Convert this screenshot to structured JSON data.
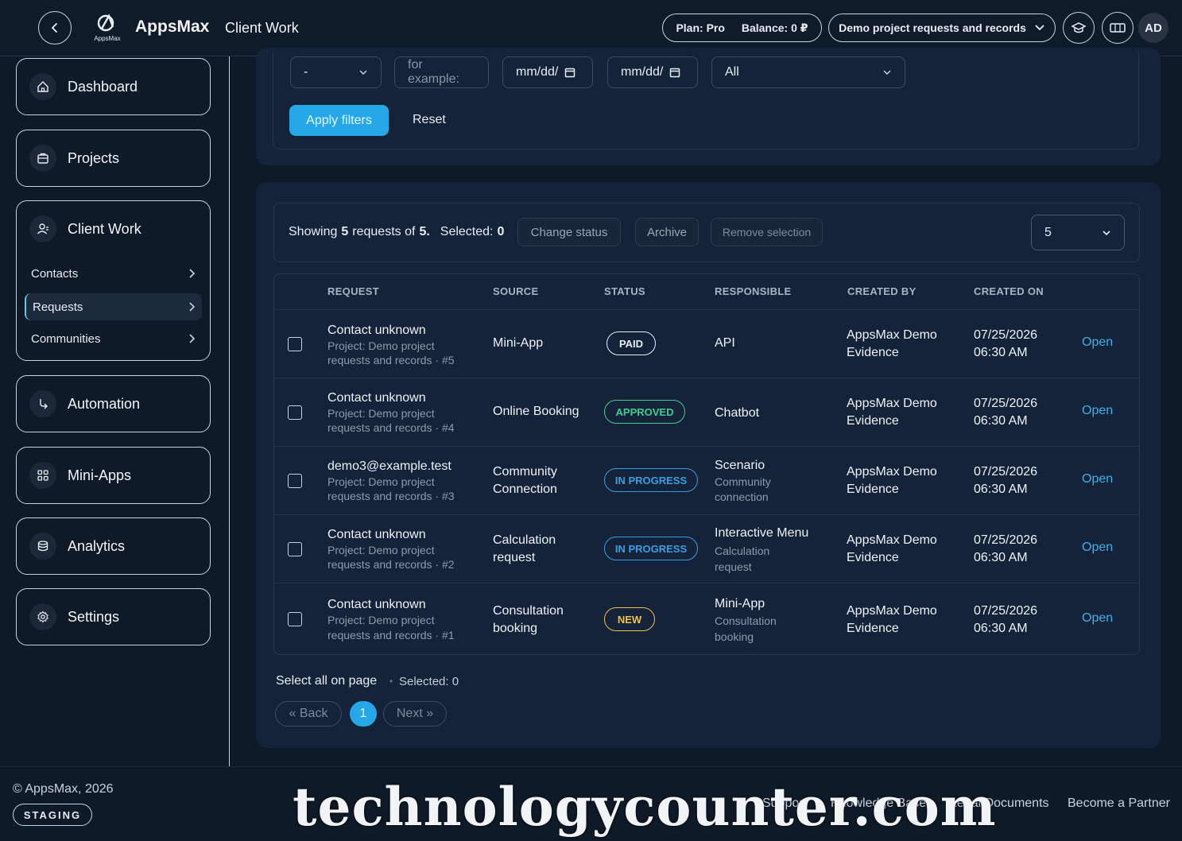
{
  "header": {
    "brand": "AppsMax",
    "logo_small": "AppsMax",
    "section": "Client Work",
    "plan": "Plan: Pro",
    "balance": "Balance: 0 ₽",
    "project": "Demo project requests and records",
    "avatar": "AD"
  },
  "sidebar": {
    "items": [
      {
        "label": "Dashboard"
      },
      {
        "label": "Projects"
      },
      {
        "label": "Client Work"
      },
      {
        "label": "Automation"
      },
      {
        "label": "Mini-Apps"
      },
      {
        "label": "Analytics"
      },
      {
        "label": "Settings"
      }
    ],
    "sub": [
      {
        "label": "Contacts"
      },
      {
        "label": "Requests"
      },
      {
        "label": "Communities"
      }
    ]
  },
  "filters": {
    "select1": "-",
    "search_placeholder": "for example:",
    "date_from": "mm/dd/",
    "date_to": "mm/dd/",
    "status": "All",
    "apply": "Apply filters",
    "reset": "Reset"
  },
  "toolbar": {
    "showing_prefix": "Showing",
    "showing_count": "5",
    "showing_mid": "requests of",
    "showing_total": "5.",
    "selected_label": "Selected:",
    "selected_count": "0",
    "change_status": "Change status",
    "archive": "Archive",
    "remove_selection": "Remove selection",
    "page_size": "5"
  },
  "table": {
    "headers": [
      "REQUEST",
      "SOURCE",
      "STATUS",
      "RESPONSIBLE",
      "CREATED BY",
      "CREATED ON"
    ],
    "rows": [
      {
        "title": "Contact unknown",
        "sub1": "Project: Demo project",
        "sub2": "requests and records · #5",
        "source1": "Mini-App",
        "source2": "",
        "status": "PAID",
        "resp": "API",
        "resp_sub1": "",
        "resp_sub2": "",
        "by1": "AppsMax Demo",
        "by2": "Evidence",
        "date": "07/25/2026",
        "time": "06:30 AM",
        "open": "Open"
      },
      {
        "title": "Contact unknown",
        "sub1": "Project: Demo project",
        "sub2": "requests and records · #4",
        "source1": "Online Booking",
        "source2": "",
        "status": "APPROVED",
        "resp": "Chatbot",
        "resp_sub1": "",
        "resp_sub2": "",
        "by1": "AppsMax Demo",
        "by2": "Evidence",
        "date": "07/25/2026",
        "time": "06:30 AM",
        "open": "Open"
      },
      {
        "title": "demo3@example.test",
        "sub1": "Project: Demo project",
        "sub2": "requests and records · #3",
        "source1": "Community",
        "source2": "Connection",
        "status": "IN PROGRESS",
        "resp": "Scenario",
        "resp_sub1": "Community",
        "resp_sub2": "connection",
        "by1": "AppsMax Demo",
        "by2": "Evidence",
        "date": "07/25/2026",
        "time": "06:30 AM",
        "open": "Open"
      },
      {
        "title": "Contact unknown",
        "sub1": "Project: Demo project",
        "sub2": "requests and records · #2",
        "source1": "Calculation",
        "source2": "request",
        "status": "IN PROGRESS",
        "resp": "Interactive Menu",
        "resp_sub1": "Calculation",
        "resp_sub2": "request",
        "by1": "AppsMax Demo",
        "by2": "Evidence",
        "date": "07/25/2026",
        "time": "06:30 AM",
        "open": "Open"
      },
      {
        "title": "Contact unknown",
        "sub1": "Project: Demo project",
        "sub2": "requests and records · #1",
        "source1": "Consultation",
        "source2": "booking",
        "status": "NEW",
        "resp": "Mini-App",
        "resp_sub1": "Consultation",
        "resp_sub2": "booking",
        "by1": "AppsMax Demo",
        "by2": "Evidence",
        "date": "07/25/2026",
        "time": "06:30 AM",
        "open": "Open"
      }
    ]
  },
  "bottom": {
    "select_all": "Select all on page",
    "selected": "Selected: 0",
    "back": "« Back",
    "page": "1",
    "next": "Next »"
  },
  "footer": {
    "copyright": "© AppsMax, 2026",
    "staging": "STAGING",
    "links": [
      "Support",
      "Knowledge Base",
      "Legal Documents",
      "Become a Partner"
    ],
    "watermark": "technologycounter.com"
  },
  "colors": {
    "accent": "#26a8e8",
    "paid": "#e8edf3",
    "approved": "#3ecf8e",
    "in_progress": "#3a9fe0",
    "new": "#f0c24a"
  }
}
